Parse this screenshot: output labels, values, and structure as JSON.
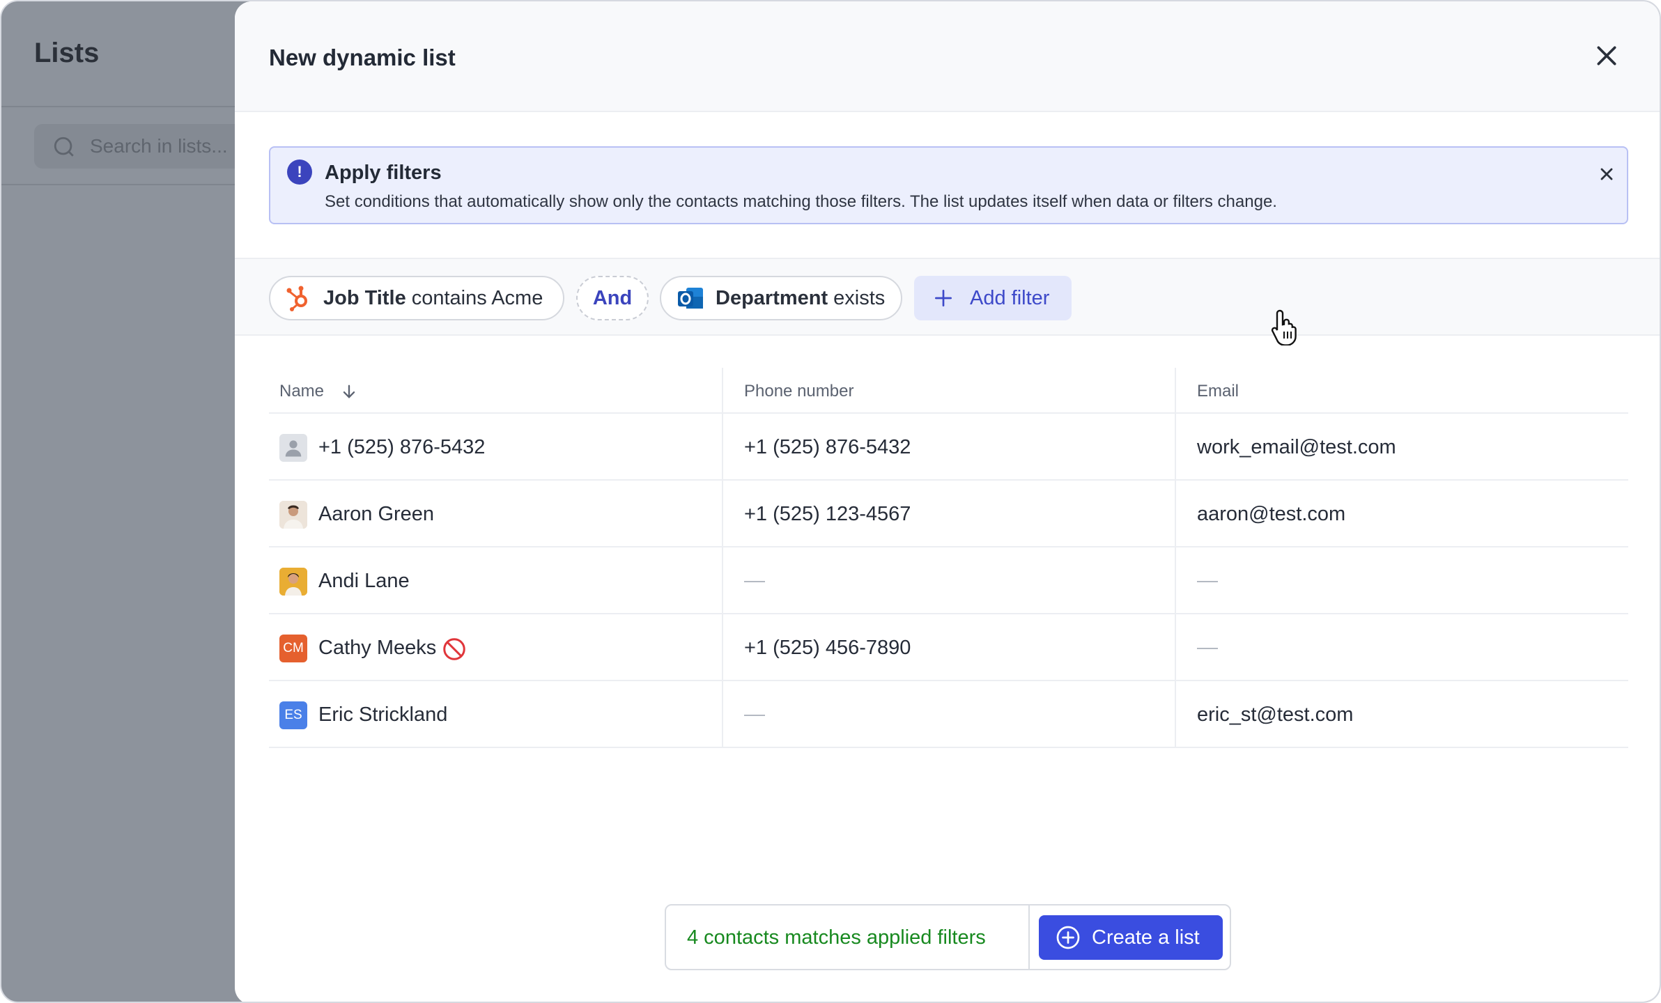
{
  "background_app": {
    "title": "Lists",
    "search_placeholder": "Search in lists..."
  },
  "modal": {
    "title": "New dynamic list",
    "close_icon": "close-icon",
    "alert": {
      "title": "Apply filters",
      "text": "Set conditions that automatically show only the contacts matching those filters. The list updates itself when data or filters change.",
      "icon": "exclamation-icon",
      "accent": "#3b44bd"
    },
    "filters": [
      {
        "field": "Job Title",
        "condition": "contains Acme",
        "source_icon": "hubspot-icon"
      },
      {
        "operator": "And"
      },
      {
        "field": "Department",
        "condition": "exists",
        "source_icon": "outlook-icon"
      }
    ],
    "add_filter_label": "Add filter",
    "table": {
      "headers": [
        "Name",
        "Phone number",
        "Email"
      ],
      "rows": [
        {
          "name": "+1 (525) 876-5432",
          "phone": "+1 (525) 876-5432",
          "email": "work_email@test.com",
          "avatar": "person-placeholder-icon"
        },
        {
          "name": "Aaron Green",
          "phone": "+1 (525) 123-4567",
          "email": "aaron@test.com",
          "avatar": "photo"
        },
        {
          "name": "Andi Lane",
          "phone": "",
          "email": "",
          "avatar": "photo"
        },
        {
          "name": "Cathy Meeks",
          "phone": "+1 (525) 456-7890",
          "email": "",
          "avatar": "CM",
          "badge": "blocked-icon"
        },
        {
          "name": "Eric Strickland",
          "phone": "",
          "email": "eric_st@test.com",
          "avatar": "ES"
        }
      ]
    },
    "footer": {
      "status": "4 contacts matches applied filters",
      "create_label": "Create a list",
      "status_color": "#17891f",
      "button_color": "#3a4de0"
    }
  }
}
